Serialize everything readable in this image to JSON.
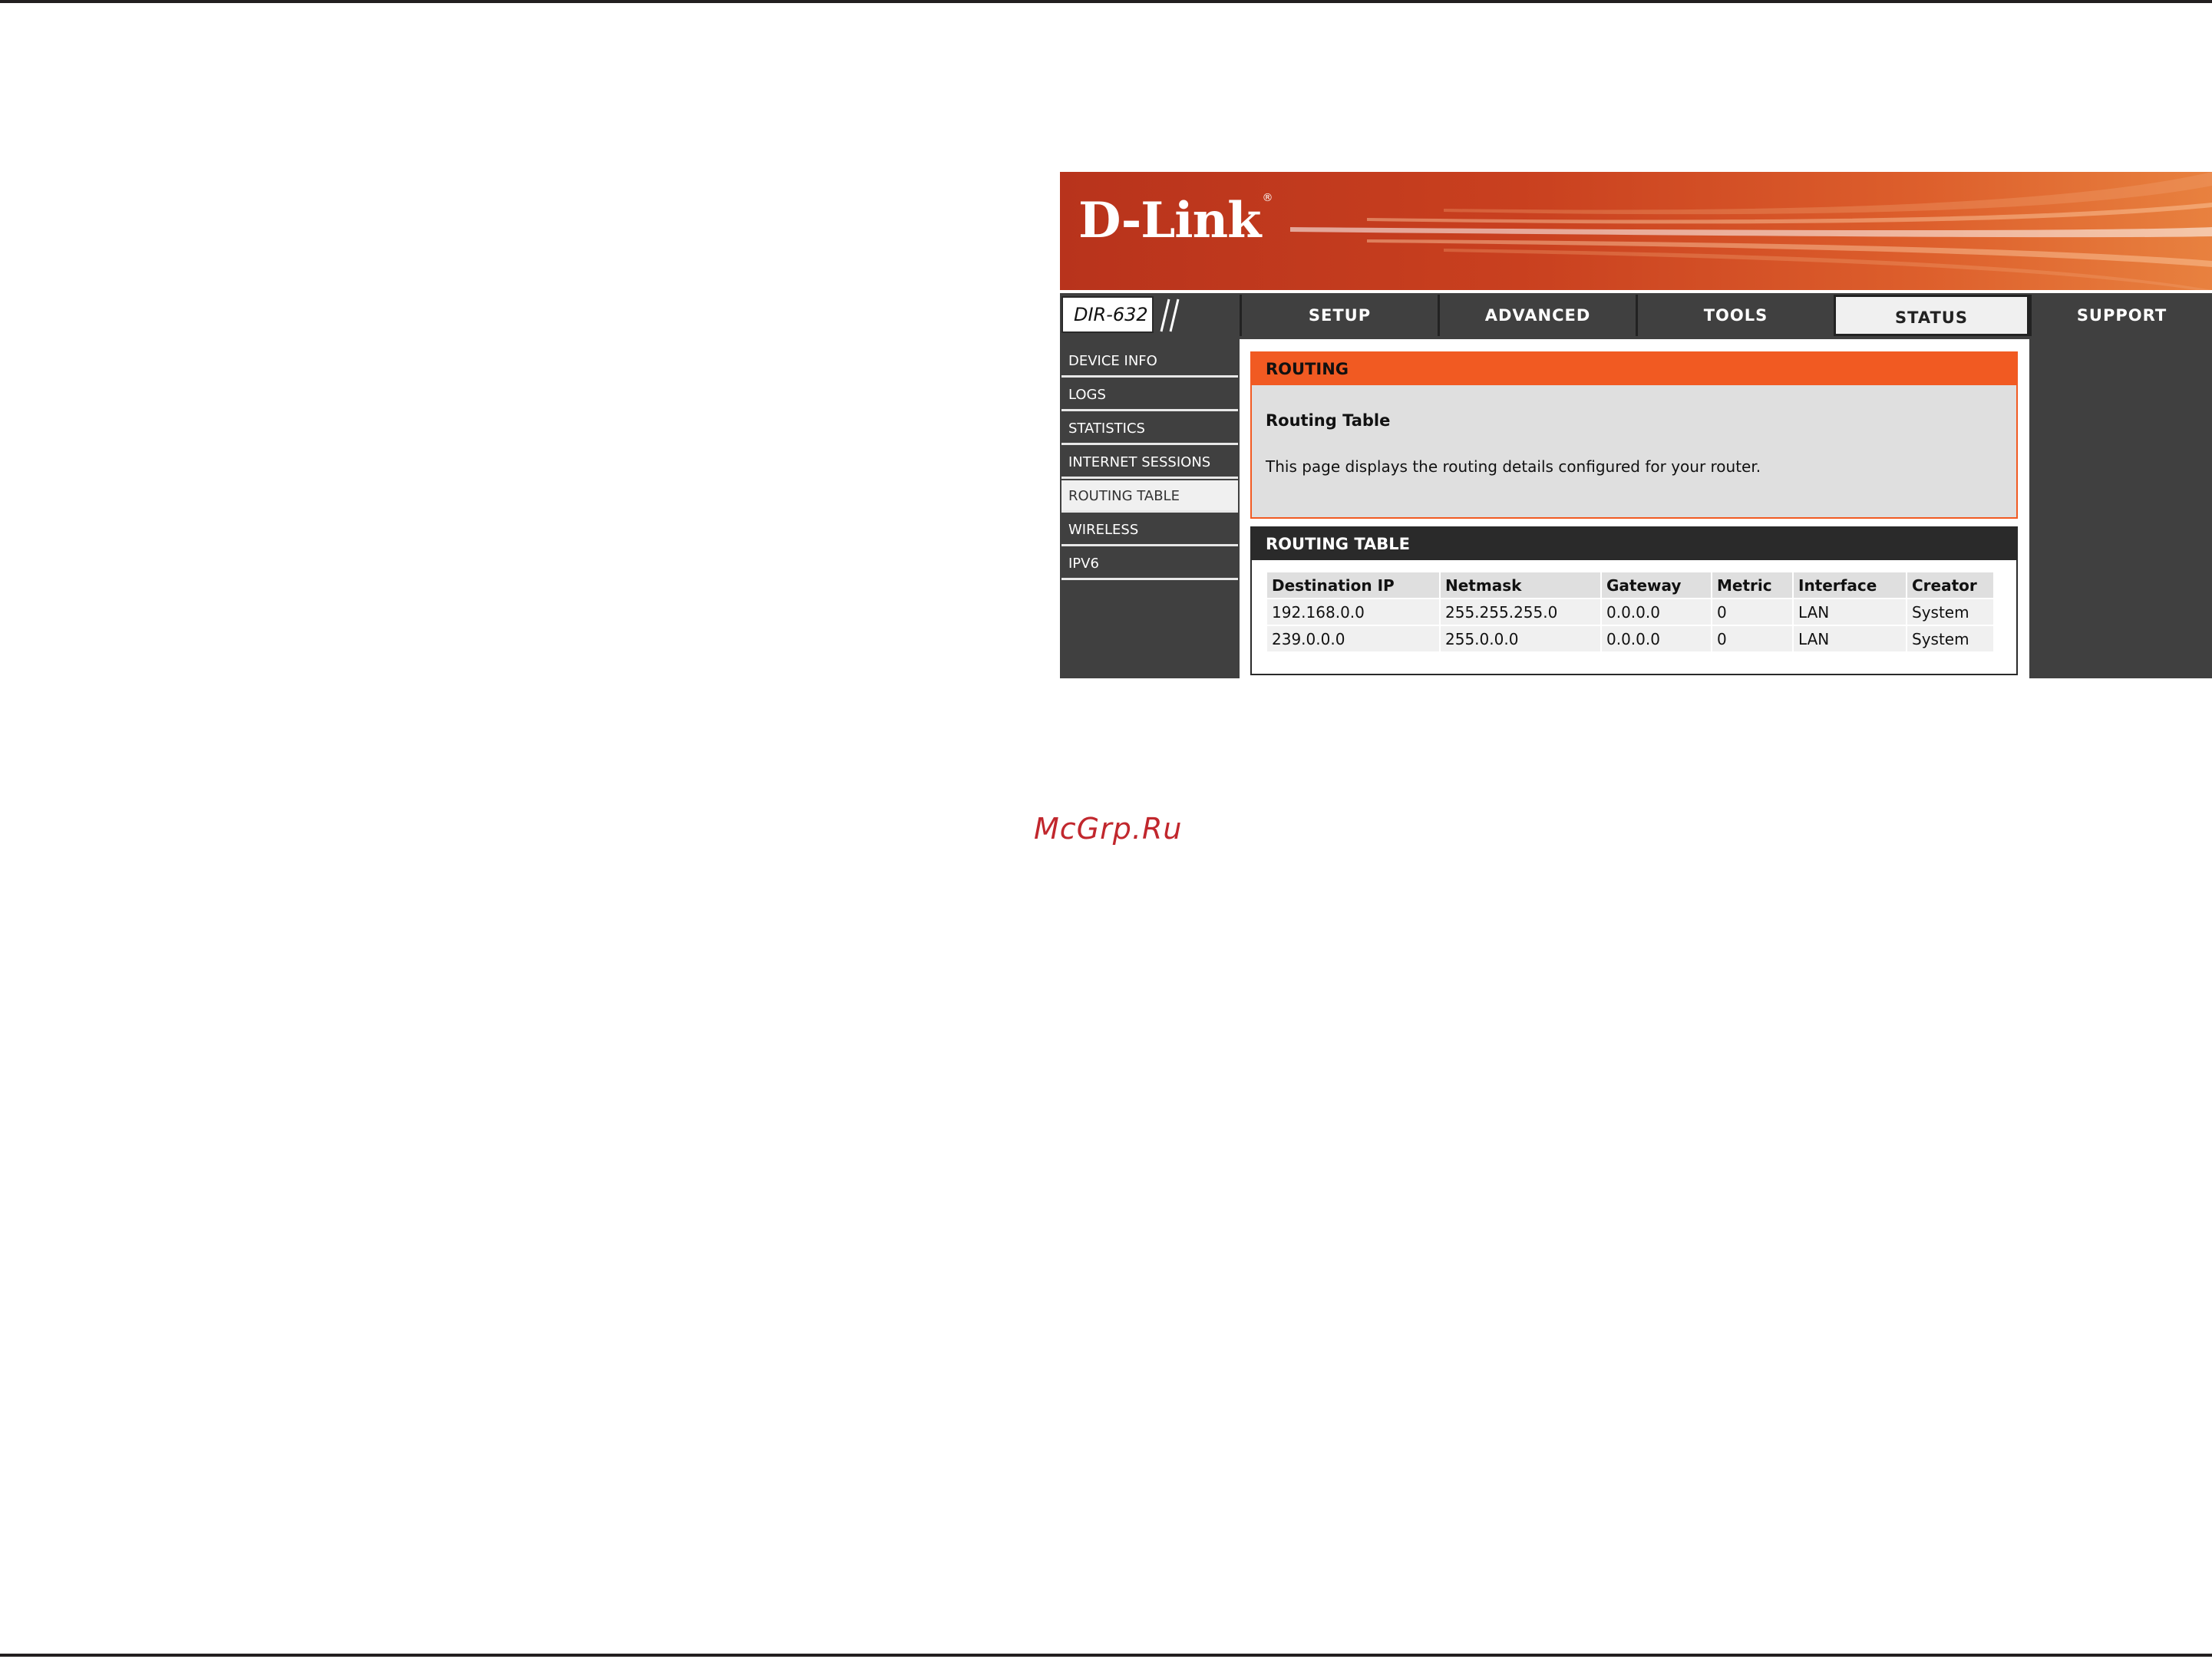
{
  "brand": {
    "logo_text": "D-Link",
    "registered_mark": "®",
    "model": "DIR-632"
  },
  "nav": {
    "tabs": [
      {
        "label": "SETUP"
      },
      {
        "label": "ADVANCED"
      },
      {
        "label": "TOOLS"
      },
      {
        "label": "STATUS",
        "active": true
      },
      {
        "label": "SUPPORT"
      }
    ]
  },
  "sidebar": {
    "items": [
      {
        "label": "DEVICE INFO"
      },
      {
        "label": "LOGS"
      },
      {
        "label": "STATISTICS"
      },
      {
        "label": "INTERNET SESSIONS"
      },
      {
        "label": "ROUTING TABLE",
        "active": true
      },
      {
        "label": "WIRELESS"
      },
      {
        "label": "IPV6"
      }
    ]
  },
  "routing": {
    "header": "ROUTING",
    "title": "Routing Table",
    "description": "This page displays the routing details configured for your router."
  },
  "routing_table": {
    "header": "ROUTING TABLE",
    "columns": [
      "Destination IP",
      "Netmask",
      "Gateway",
      "Metric",
      "Interface",
      "Creator"
    ],
    "rows": [
      [
        "192.168.0.0",
        "255.255.255.0",
        "0.0.0.0",
        "0",
        "LAN",
        "System"
      ],
      [
        "239.0.0.0",
        "255.0.0.0",
        "0.0.0.0",
        "0",
        "LAN",
        "System"
      ]
    ]
  },
  "watermark": "McGrp.Ru",
  "colors": {
    "accent_orange": "#f15a22",
    "nav_dark": "#404040",
    "watermark_red": "#c1272d"
  }
}
